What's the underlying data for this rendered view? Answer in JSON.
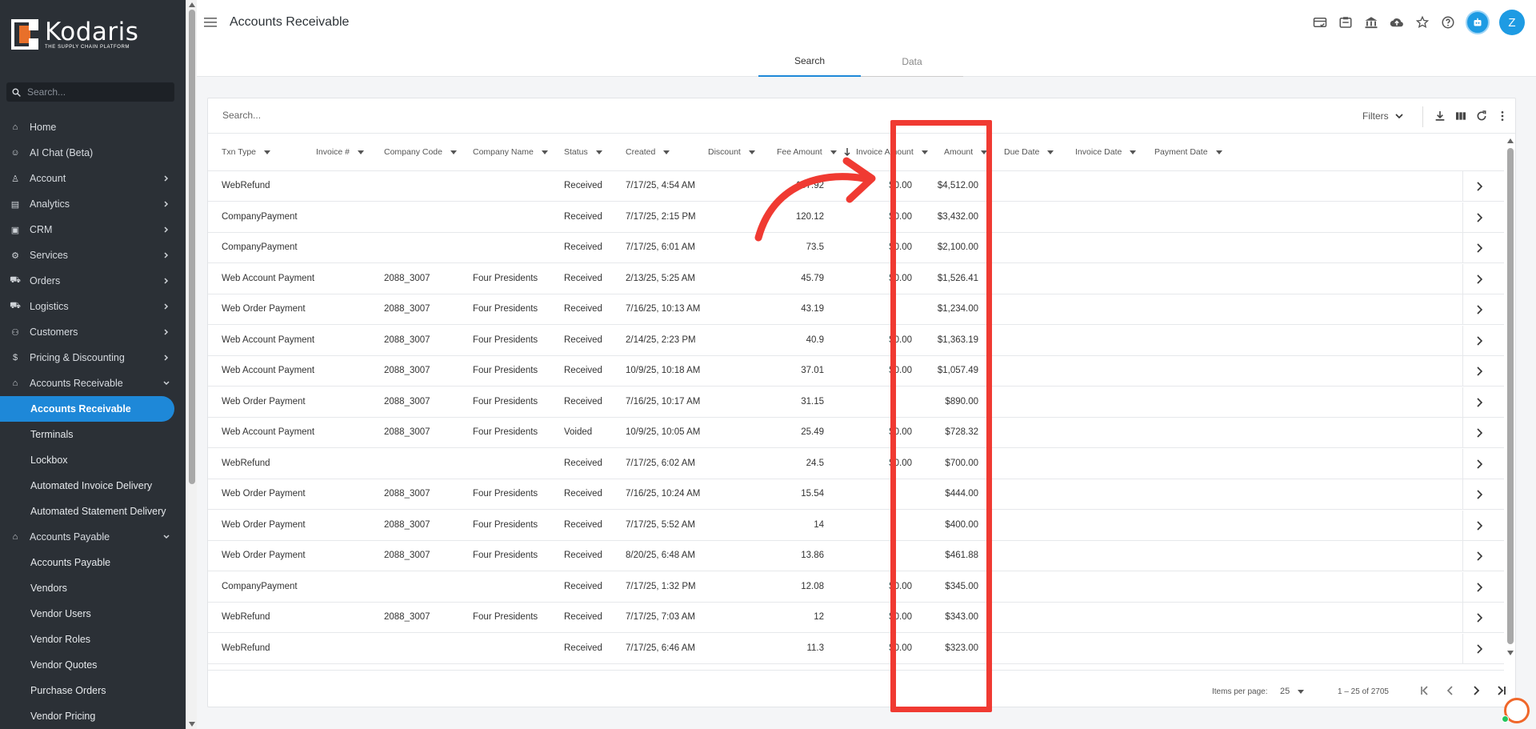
{
  "brand": {
    "name": "Kodaris",
    "tagline": "THE SUPPLY CHAIN PLATFORM",
    "accent": "#1e88d8",
    "logo_orange": "#e8702a"
  },
  "sidebar": {
    "search_placeholder": "Search...",
    "items": [
      {
        "label": "Home",
        "icon": "home-icon",
        "chevron": false
      },
      {
        "label": "AI Chat (Beta)",
        "icon": "robot-icon",
        "chevron": false
      },
      {
        "label": "Account",
        "icon": "person-icon",
        "chevron": true
      },
      {
        "label": "Analytics",
        "icon": "analytics-icon",
        "chevron": true
      },
      {
        "label": "CRM",
        "icon": "contact-card-icon",
        "chevron": true
      },
      {
        "label": "Services",
        "icon": "services-icon",
        "chevron": true
      },
      {
        "label": "Orders",
        "icon": "car-icon",
        "chevron": true
      },
      {
        "label": "Logistics",
        "icon": "truck-icon",
        "chevron": true
      },
      {
        "label": "Customers",
        "icon": "people-icon",
        "chevron": true
      },
      {
        "label": "Pricing & Discounting",
        "icon": "dollar-icon",
        "chevron": true
      }
    ],
    "ar_section": {
      "label": "Accounts Receivable",
      "icon": "bank-icon",
      "children": [
        "Accounts Receivable",
        "Terminals",
        "Lockbox",
        "Automated Invoice Delivery",
        "Automated Statement Delivery"
      ]
    },
    "ap_section": {
      "label": "Accounts Payable",
      "icon": "bank-icon",
      "children": [
        "Accounts Payable",
        "Vendors",
        "Vendor Users",
        "Vendor Roles",
        "Vendor Quotes",
        "Purchase Orders",
        "Vendor Pricing"
      ]
    }
  },
  "header": {
    "title": "Accounts Receivable",
    "avatar_initial": "Z",
    "icons": [
      "credit-card-check-icon",
      "clipboard-box-icon",
      "bank-icon",
      "cloud-upload-icon",
      "star-icon",
      "help-icon",
      "robot-assistant-icon"
    ]
  },
  "tabs": [
    {
      "label": "Search"
    },
    {
      "label": "Data"
    }
  ],
  "grid": {
    "search_placeholder": "Search...",
    "filters_label": "Filters",
    "columns": [
      "Txn Type",
      "Invoice #",
      "Company Code",
      "Company Name",
      "Status",
      "Created",
      "Discount",
      "Fee Amount",
      "Invoice Amount",
      "Amount",
      "Due Date",
      "Invoice Date",
      "Payment Date"
    ],
    "sorted_column": "Fee Amount",
    "rows": [
      {
        "txn": "WebRefund",
        "inv": "",
        "code": "",
        "name": "",
        "status": "Received",
        "created": "7/17/25, 4:54 AM",
        "discount": "",
        "fee": "157.92",
        "invamt": "$0.00",
        "amount": "$4,512.00"
      },
      {
        "txn": "CompanyPayment",
        "inv": "",
        "code": "",
        "name": "",
        "status": "Received",
        "created": "7/17/25, 2:15 PM",
        "discount": "",
        "fee": "120.12",
        "invamt": "$0.00",
        "amount": "$3,432.00"
      },
      {
        "txn": "CompanyPayment",
        "inv": "",
        "code": "",
        "name": "",
        "status": "Received",
        "created": "7/17/25, 6:01 AM",
        "discount": "",
        "fee": "73.5",
        "invamt": "$0.00",
        "amount": "$2,100.00"
      },
      {
        "txn": "Web Account Payment",
        "inv": "",
        "code": "2088_3007",
        "name": "Four Presidents",
        "status": "Received",
        "created": "2/13/25, 5:25 AM",
        "discount": "",
        "fee": "45.79",
        "invamt": "$0.00",
        "amount": "$1,526.41"
      },
      {
        "txn": "Web Order Payment",
        "inv": "",
        "code": "2088_3007",
        "name": "Four Presidents",
        "status": "Received",
        "created": "7/16/25, 10:13 AM",
        "discount": "",
        "fee": "43.19",
        "invamt": "",
        "amount": "$1,234.00"
      },
      {
        "txn": "Web Account Payment",
        "inv": "",
        "code": "2088_3007",
        "name": "Four Presidents",
        "status": "Received",
        "created": "2/14/25, 2:23 PM",
        "discount": "",
        "fee": "40.9",
        "invamt": "$0.00",
        "amount": "$1,363.19"
      },
      {
        "txn": "Web Account Payment",
        "inv": "",
        "code": "2088_3007",
        "name": "Four Presidents",
        "status": "Received",
        "created": "10/9/25, 10:18 AM",
        "discount": "",
        "fee": "37.01",
        "invamt": "$0.00",
        "amount": "$1,057.49"
      },
      {
        "txn": "Web Order Payment",
        "inv": "",
        "code": "2088_3007",
        "name": "Four Presidents",
        "status": "Received",
        "created": "7/16/25, 10:17 AM",
        "discount": "",
        "fee": "31.15",
        "invamt": "",
        "amount": "$890.00"
      },
      {
        "txn": "Web Account Payment",
        "inv": "",
        "code": "2088_3007",
        "name": "Four Presidents",
        "status": "Voided",
        "created": "10/9/25, 10:05 AM",
        "discount": "",
        "fee": "25.49",
        "invamt": "$0.00",
        "amount": "$728.32"
      },
      {
        "txn": "WebRefund",
        "inv": "",
        "code": "",
        "name": "",
        "status": "Received",
        "created": "7/17/25, 6:02 AM",
        "discount": "",
        "fee": "24.5",
        "invamt": "$0.00",
        "amount": "$700.00"
      },
      {
        "txn": "Web Order Payment",
        "inv": "",
        "code": "2088_3007",
        "name": "Four Presidents",
        "status": "Received",
        "created": "7/16/25, 10:24 AM",
        "discount": "",
        "fee": "15.54",
        "invamt": "",
        "amount": "$444.00"
      },
      {
        "txn": "Web Order Payment",
        "inv": "",
        "code": "2088_3007",
        "name": "Four Presidents",
        "status": "Received",
        "created": "7/17/25, 5:52 AM",
        "discount": "",
        "fee": "14",
        "invamt": "",
        "amount": "$400.00"
      },
      {
        "txn": "Web Order Payment",
        "inv": "",
        "code": "2088_3007",
        "name": "Four Presidents",
        "status": "Received",
        "created": "8/20/25, 6:48 AM",
        "discount": "",
        "fee": "13.86",
        "invamt": "",
        "amount": "$461.88"
      },
      {
        "txn": "CompanyPayment",
        "inv": "",
        "code": "",
        "name": "",
        "status": "Received",
        "created": "7/17/25, 1:32 PM",
        "discount": "",
        "fee": "12.08",
        "invamt": "$0.00",
        "amount": "$345.00"
      },
      {
        "txn": "WebRefund",
        "inv": "",
        "code": "2088_3007",
        "name": "Four Presidents",
        "status": "Received",
        "created": "7/17/25, 7:03 AM",
        "discount": "",
        "fee": "12",
        "invamt": "$0.00",
        "amount": "$343.00"
      },
      {
        "txn": "WebRefund",
        "inv": "",
        "code": "",
        "name": "",
        "status": "Received",
        "created": "7/17/25, 6:46 AM",
        "discount": "",
        "fee": "11.3",
        "invamt": "$0.00",
        "amount": "$323.00"
      }
    ]
  },
  "pager": {
    "items_per_page_label": "Items per page:",
    "items_per_page": "25",
    "range": "1 – 25 of 2705"
  },
  "annotation": {
    "color": "#f03a32"
  }
}
